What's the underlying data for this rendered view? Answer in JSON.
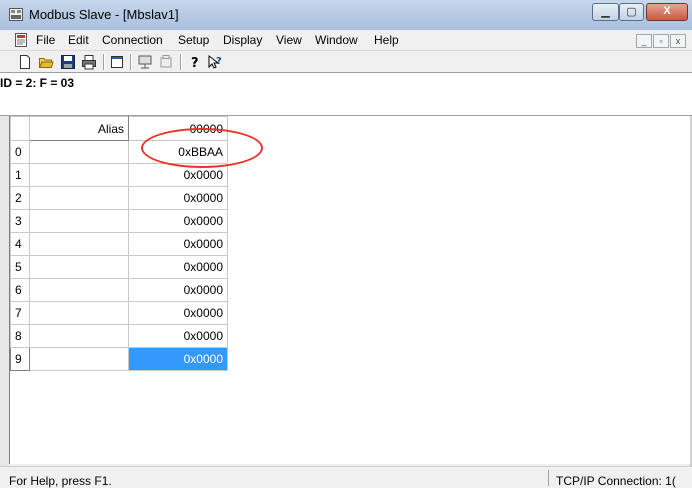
{
  "window": {
    "title": "Modbus Slave - [Mbslav1]"
  },
  "menu": [
    "File",
    "Edit",
    "Connection",
    "Setup",
    "Display",
    "View",
    "Window",
    "Help"
  ],
  "toolbar": {
    "icons": [
      "new-icon",
      "open-icon",
      "save-icon",
      "print-icon",
      "window-icon",
      "connect-icon",
      "disconnect-icon",
      "help-icon",
      "context-help-icon"
    ]
  },
  "info": "ID = 2: F = 03",
  "grid": {
    "alias_header": "Alias",
    "address_header": "00000",
    "rows": [
      {
        "index": "0",
        "alias": "",
        "value": "0xBBAA"
      },
      {
        "index": "1",
        "alias": "",
        "value": "0x0000"
      },
      {
        "index": "2",
        "alias": "",
        "value": "0x0000"
      },
      {
        "index": "3",
        "alias": "",
        "value": "0x0000"
      },
      {
        "index": "4",
        "alias": "",
        "value": "0x0000"
      },
      {
        "index": "5",
        "alias": "",
        "value": "0x0000"
      },
      {
        "index": "6",
        "alias": "",
        "value": "0x0000"
      },
      {
        "index": "7",
        "alias": "",
        "value": "0x0000"
      },
      {
        "index": "8",
        "alias": "",
        "value": "0x0000"
      },
      {
        "index": "9",
        "alias": "",
        "value": "0x0000"
      }
    ],
    "selected_row": 9
  },
  "status": {
    "help": "For Help, press F1.",
    "connection": "TCP/IP Connection: 1("
  },
  "colors": {
    "selection": "#3399ff",
    "annotation": "#e8312b"
  }
}
